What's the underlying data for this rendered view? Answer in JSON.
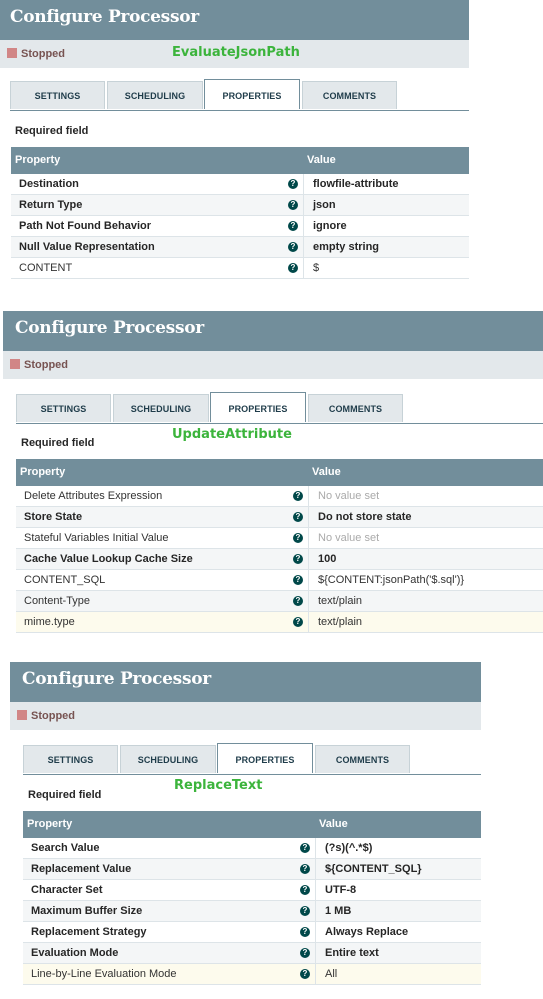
{
  "panels": [
    {
      "title": "Configure Processor",
      "status": "Stopped",
      "processor_label": "EvaluateJsonPath",
      "tabs": [
        "SETTINGS",
        "SCHEDULING",
        "PROPERTIES",
        "COMMENTS"
      ],
      "active_tab": "PROPERTIES",
      "required_field": "Required field",
      "header": {
        "property": "Property",
        "value": "Value"
      },
      "rows": [
        {
          "name": "Destination",
          "value": "flowfile-attribute"
        },
        {
          "name": "Return Type",
          "value": "json"
        },
        {
          "name": "Path Not Found Behavior",
          "value": "ignore"
        },
        {
          "name": "Null Value Representation",
          "value": "empty string"
        },
        {
          "name": "CONTENT",
          "value": "$"
        }
      ]
    },
    {
      "title": "Configure Processor",
      "status": "Stopped",
      "processor_label": "UpdateAttribute",
      "tabs": [
        "SETTINGS",
        "SCHEDULING",
        "PROPERTIES",
        "COMMENTS"
      ],
      "active_tab": "PROPERTIES",
      "required_field": "Required field",
      "header": {
        "property": "Property",
        "value": "Value"
      },
      "rows": [
        {
          "name": "Delete Attributes Expression",
          "value": "No value set"
        },
        {
          "name": "Store State",
          "value": "Do not store state"
        },
        {
          "name": "Stateful Variables Initial Value",
          "value": "No value set"
        },
        {
          "name": "Cache Value Lookup Cache Size",
          "value": "100"
        },
        {
          "name": "CONTENT_SQL",
          "value": "${CONTENT:jsonPath('$.sql')}"
        },
        {
          "name": "Content-Type",
          "value": "text/plain"
        },
        {
          "name": "mime.type",
          "value": "text/plain"
        }
      ]
    },
    {
      "title": "Configure Processor",
      "status": "Stopped",
      "processor_label": "ReplaceText",
      "tabs": [
        "SETTINGS",
        "SCHEDULING",
        "PROPERTIES",
        "COMMENTS"
      ],
      "active_tab": "PROPERTIES",
      "required_field": "Required field",
      "header": {
        "property": "Property",
        "value": "Value"
      },
      "rows": [
        {
          "name": "Search Value",
          "value": "(?s)(^.*$)"
        },
        {
          "name": "Replacement Value",
          "value": "${CONTENT_SQL}"
        },
        {
          "name": "Character Set",
          "value": "UTF-8"
        },
        {
          "name": "Maximum Buffer Size",
          "value": "1 MB"
        },
        {
          "name": "Replacement Strategy",
          "value": "Always Replace"
        },
        {
          "name": "Evaluation Mode",
          "value": "Entire text"
        },
        {
          "name": "Line-by-Line Evaluation Mode",
          "value": "All"
        }
      ]
    }
  ],
  "colors": {
    "header_bg": "#728e9b",
    "status_bg": "#e3e8eb",
    "stopped_square": "#d18686",
    "processor_label": "#3cb43c",
    "help_icon": "#004849",
    "highlight_row": "#fdfbed"
  },
  "icons": {
    "status": "stopped-square-icon",
    "help": "help-question-icon"
  }
}
